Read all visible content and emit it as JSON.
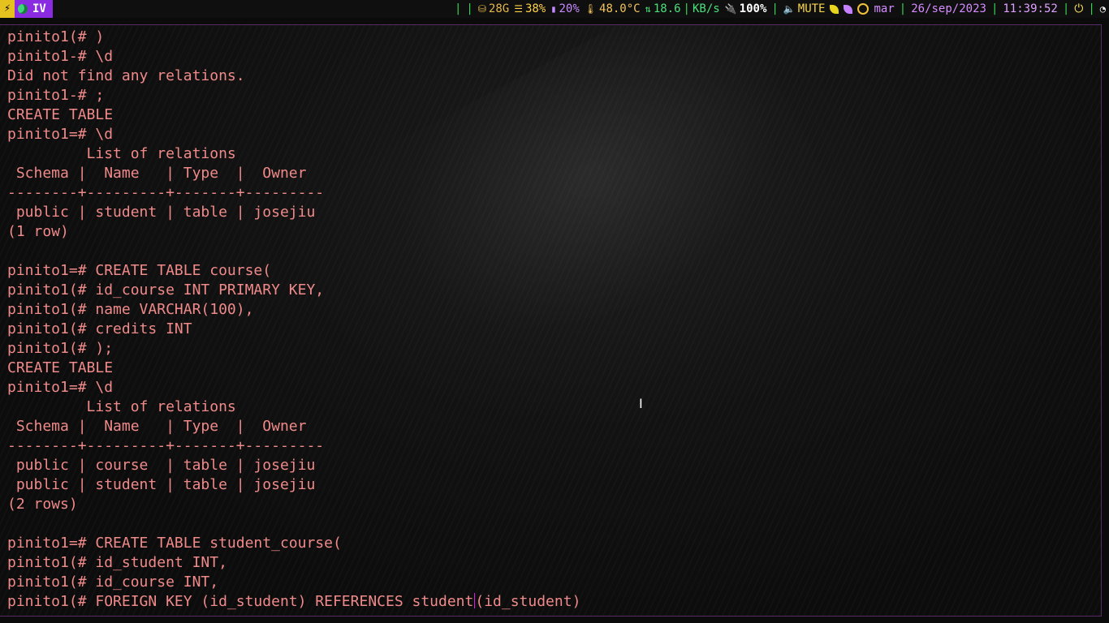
{
  "statusbar": {
    "menu_icon": "menu-lightning-icon",
    "workspace": {
      "icon": "moon-icon",
      "label": "IV"
    },
    "disk": {
      "icon": "disk-icon",
      "value": "28G"
    },
    "memory": {
      "icon": "memory-icon",
      "value": "38%"
    },
    "cpu": {
      "icon": "cpu-icon",
      "value": "20%"
    },
    "temperature": {
      "icon": "thermometer-icon",
      "value": "48.0°C"
    },
    "network": {
      "icon": "network-updown-icon",
      "value": "18.6",
      "unit": "KB/s"
    },
    "battery": {
      "icon": "plug-icon",
      "value": "100%"
    },
    "volume": {
      "icon": "speaker-icon",
      "value": "MUTE"
    },
    "day": "mar",
    "date": "26/sep/2023",
    "time": "11:39:52",
    "power_icon": "power-icon",
    "wifi_icon": "wifi-icon",
    "colors": {
      "workspace_bg": "#8a2be2",
      "menu_bg": "#e6c21e",
      "separator": "#39d353"
    }
  },
  "terminal": {
    "text_color": "#f08a8a",
    "lines": [
      "pinito1(# )",
      "pinito1-# \\d",
      "Did not find any relations.",
      "pinito1-# ;",
      "CREATE TABLE",
      "pinito1=# \\d",
      "         List of relations",
      " Schema |  Name   | Type  |  Owner",
      "--------+---------+-------+---------",
      " public | student | table | josejiu",
      "(1 row)",
      "",
      "pinito1=# CREATE TABLE course(",
      "pinito1(# id_course INT PRIMARY KEY,",
      "pinito1(# name VARCHAR(100),",
      "pinito1(# credits INT",
      "pinito1(# );",
      "CREATE TABLE",
      "pinito1=# \\d",
      "         List of relations",
      " Schema |  Name   | Type  |  Owner",
      "--------+---------+-------+---------",
      " public | course  | table | josejiu",
      " public | student | table | josejiu",
      "(2 rows)",
      "",
      "pinito1=# CREATE TABLE student_course(",
      "pinito1(# id_student INT,",
      "pinito1(# id_course INT,"
    ],
    "current_line_before_cursor": "pinito1(# FOREIGN KEY (id_student) REFERENCES student",
    "current_line_after_cursor": "(id_student)"
  }
}
